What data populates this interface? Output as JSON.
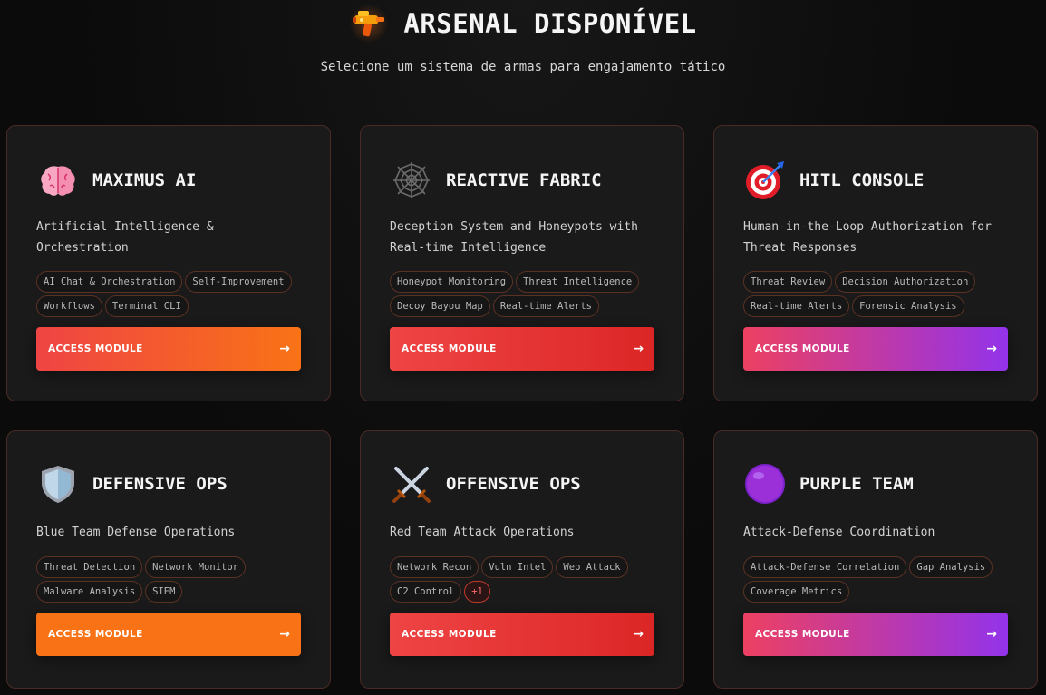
{
  "header": {
    "title": "ARSENAL DISPONÍVEL",
    "title_icon": "water-gun-icon",
    "subtitle": "Selecione um sistema de armas para engajamento tático"
  },
  "colors": {
    "card_bg": "#1a1a1b",
    "card_border": "#4a2a24",
    "orange": "#f97316",
    "red": "#ef4444",
    "purple": "#9333ea"
  },
  "cards": [
    {
      "title": "MAXIMUS AI",
      "icon": "brain-icon",
      "description": "Artificial Intelligence & Orchestration",
      "tags": [
        "AI Chat & Orchestration",
        "Self-Improvement",
        "Workflows",
        "Terminal CLI"
      ],
      "button_label": "ACCESS MODULE",
      "button_arrow": "→"
    },
    {
      "title": "REACTIVE FABRIC",
      "icon": "spider-web-icon",
      "description": "Deception System and Honeypots with Real-time Intelligence",
      "tags": [
        "Honeypot Monitoring",
        "Threat Intelligence",
        "Decoy Bayou Map",
        "Real-time Alerts"
      ],
      "button_label": "ACCESS MODULE",
      "button_arrow": "→"
    },
    {
      "title": "HITL CONSOLE",
      "icon": "target-icon",
      "description": "Human-in-the-Loop Authorization for Threat Responses",
      "tags": [
        "Threat Review",
        "Decision Authorization",
        "Real-time Alerts",
        "Forensic Analysis"
      ],
      "button_label": "ACCESS MODULE",
      "button_arrow": "→"
    },
    {
      "title": "DEFENSIVE OPS",
      "icon": "shield-icon",
      "description": "Blue Team Defense Operations",
      "tags": [
        "Threat Detection",
        "Network Monitor",
        "Malware Analysis",
        "SIEM"
      ],
      "button_label": "ACCESS MODULE",
      "button_arrow": "→"
    },
    {
      "title": "OFFENSIVE OPS",
      "icon": "crossed-swords-icon",
      "description": "Red Team Attack Operations",
      "tags": [
        "Network Recon",
        "Vuln Intel",
        "Web Attack",
        "C2 Control"
      ],
      "more_tag": "+1",
      "button_label": "ACCESS MODULE",
      "button_arrow": "→"
    },
    {
      "title": "PURPLE TEAM",
      "icon": "purple-circle-icon",
      "description": "Attack-Defense Coordination",
      "tags": [
        "Attack-Defense Correlation",
        "Gap Analysis",
        "Coverage Metrics"
      ],
      "button_label": "ACCESS MODULE",
      "button_arrow": "→"
    }
  ]
}
